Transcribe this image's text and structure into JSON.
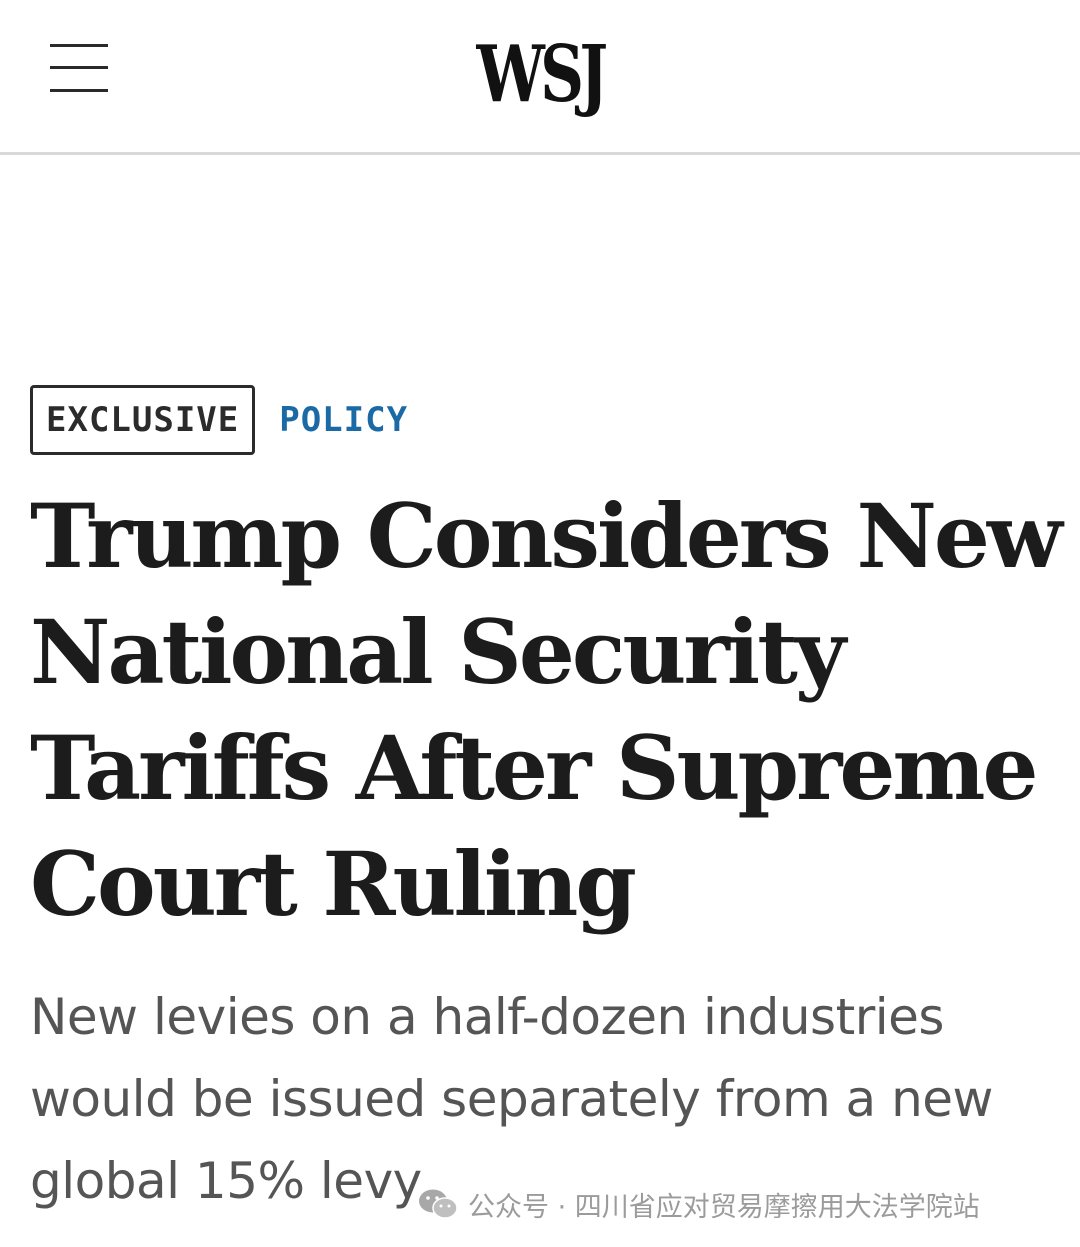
{
  "header": {
    "logo": "WSJ",
    "menu_icon": "hamburger-menu-icon"
  },
  "article": {
    "tags": {
      "exclusive": "EXCLUSIVE",
      "section": "POLICY"
    },
    "headline": "Trump Considers New National Security Tariffs After Supreme Court Ruling",
    "subheadline": "New levies on a half-dozen industries would be issued separately from a new global 15% levy"
  },
  "watermark": {
    "icon": "wechat-icon",
    "text": "公众号 · 四川省应对贸易摩擦用大法学院站"
  },
  "colors": {
    "section_tag": "#1b6aa6",
    "headline": "#1c1c1c",
    "subheadline": "#555555",
    "divider": "#d9d9d9"
  }
}
